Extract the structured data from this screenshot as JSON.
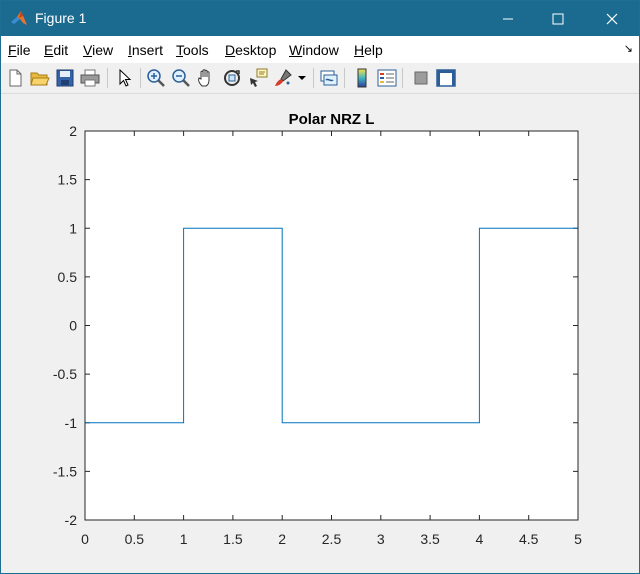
{
  "window": {
    "title": "Figure 1",
    "icon": "matlab-icon",
    "controls": [
      "minimize-icon",
      "maximize-icon",
      "close-icon"
    ]
  },
  "menu": {
    "items": [
      {
        "pre": "",
        "u": "F",
        "post": "ile"
      },
      {
        "pre": "",
        "u": "E",
        "post": "dit"
      },
      {
        "pre": "",
        "u": "V",
        "post": "iew"
      },
      {
        "pre": "",
        "u": "I",
        "post": "nsert"
      },
      {
        "pre": "",
        "u": "T",
        "post": "ools"
      },
      {
        "pre": "",
        "u": "D",
        "post": "esktop"
      },
      {
        "pre": "",
        "u": "W",
        "post": "indow"
      },
      {
        "pre": "",
        "u": "H",
        "post": "elp"
      }
    ],
    "dock_glyph": "↘"
  },
  "toolbar": {
    "icons": [
      "new-figure-icon",
      "open-file-icon",
      "save-icon",
      "print-icon",
      "pointer-icon",
      "zoom-in-icon",
      "zoom-out-icon",
      "pan-hand-icon",
      "rotate-3d-icon",
      "data-cursor-icon",
      "brush-icon",
      "brush-dropdown-icon",
      "link-plot-icon",
      "colorbar-icon",
      "legend-icon",
      "hide-plot-tools-icon",
      "show-plot-tools-icon"
    ]
  },
  "chart_data": {
    "type": "line",
    "title": "Polar NRZ L",
    "xlabel": "",
    "ylabel": "",
    "xlim": [
      0,
      5
    ],
    "ylim": [
      -2,
      2
    ],
    "xticks": [
      "0",
      "0.5",
      "1",
      "1.5",
      "2",
      "2.5",
      "3",
      "3.5",
      "4",
      "4.5",
      "5"
    ],
    "yticks": [
      "2",
      "1.5",
      "1",
      "0.5",
      "0",
      "-0.5",
      "-1",
      "-1.5",
      "-2"
    ],
    "grid": false,
    "series": [
      {
        "color": "#0072bd",
        "x": [
          0,
          1,
          1,
          2,
          2,
          3,
          3,
          4,
          4,
          5
        ],
        "y": [
          -1,
          -1,
          1,
          1,
          -1,
          -1,
          -1,
          -1,
          1,
          1
        ]
      }
    ]
  }
}
